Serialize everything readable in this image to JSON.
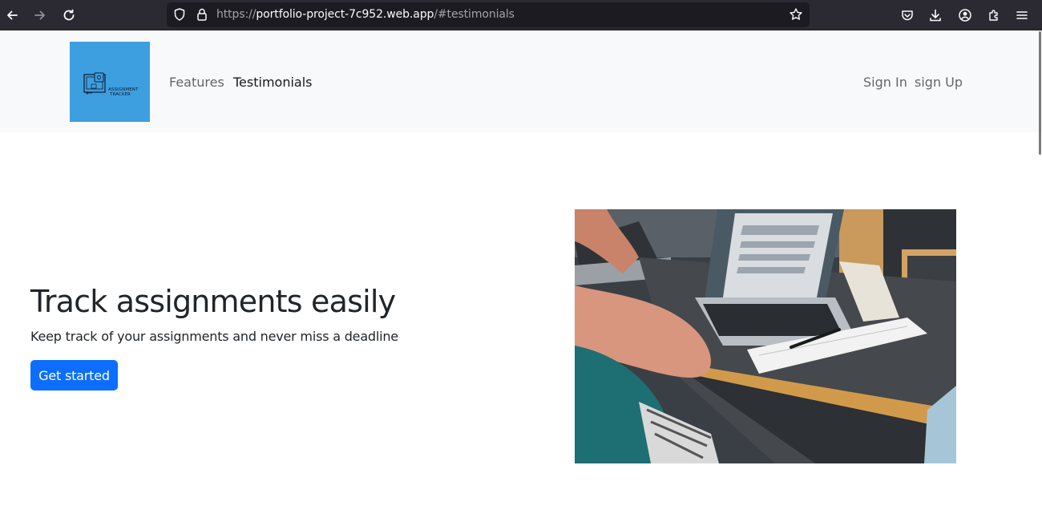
{
  "browser": {
    "url_prefix": "https://",
    "url_host": "portfolio-project-7c952.web.app",
    "url_rest": "/#testimonials"
  },
  "navbar": {
    "brand_text_line1": "ASSIGNMENT",
    "brand_text_line2": "TRACKER",
    "links": [
      {
        "label": "Features"
      },
      {
        "label": "Testimonials"
      }
    ],
    "auth": {
      "sign_in": "Sign In",
      "sign_up": "sign Up"
    }
  },
  "hero": {
    "title": "Track assignments easily",
    "subtitle": "Keep track of your assignments and never miss a deadline",
    "cta_label": "Get started"
  },
  "colors": {
    "toolbar_bg": "#2b2a33",
    "navbar_bg": "#f8f9fa",
    "brand_bg": "#3e9fe0",
    "primary": "#0d6efd",
    "text": "#212529"
  },
  "icons": {
    "back": "arrow-left-icon",
    "forward": "arrow-right-icon",
    "reload": "reload-icon",
    "tracking": "shield-icon",
    "lock": "lock-icon",
    "bookmark": "star-icon",
    "pocket": "pocket-icon",
    "downloads": "download-icon",
    "account": "account-icon",
    "extensions": "puzzle-icon",
    "menu": "hamburger-menu-icon"
  }
}
